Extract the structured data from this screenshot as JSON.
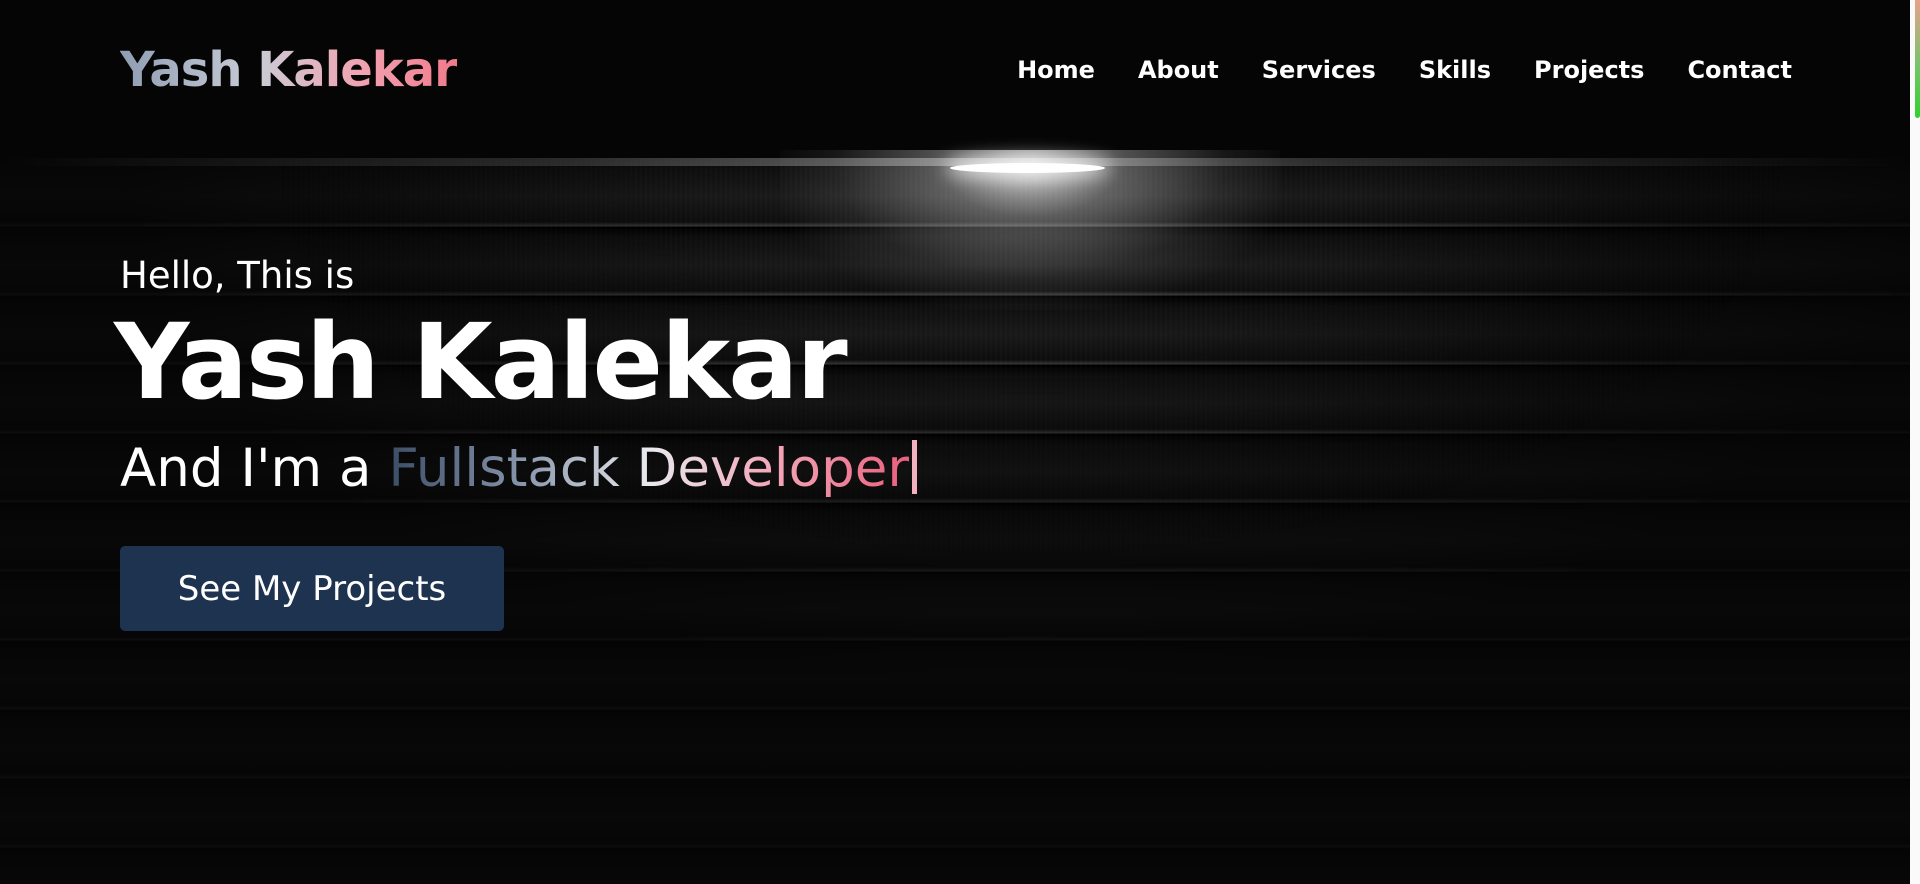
{
  "header": {
    "logo": "Yash Kalekar",
    "nav": [
      "Home",
      "About",
      "Services",
      "Skills",
      "Projects",
      "Contact"
    ]
  },
  "hero": {
    "greeting": "Hello, This is",
    "name": "Yash Kalekar",
    "role_prefix": "And I'm a ",
    "role_typed": "Fullstack Developer",
    "cta_label": "See My Projects"
  },
  "colors": {
    "button_bg": "#1e3350",
    "text": "#ffffff",
    "gradient_start": "#3b4c66",
    "gradient_end": "#ea5f7d"
  }
}
